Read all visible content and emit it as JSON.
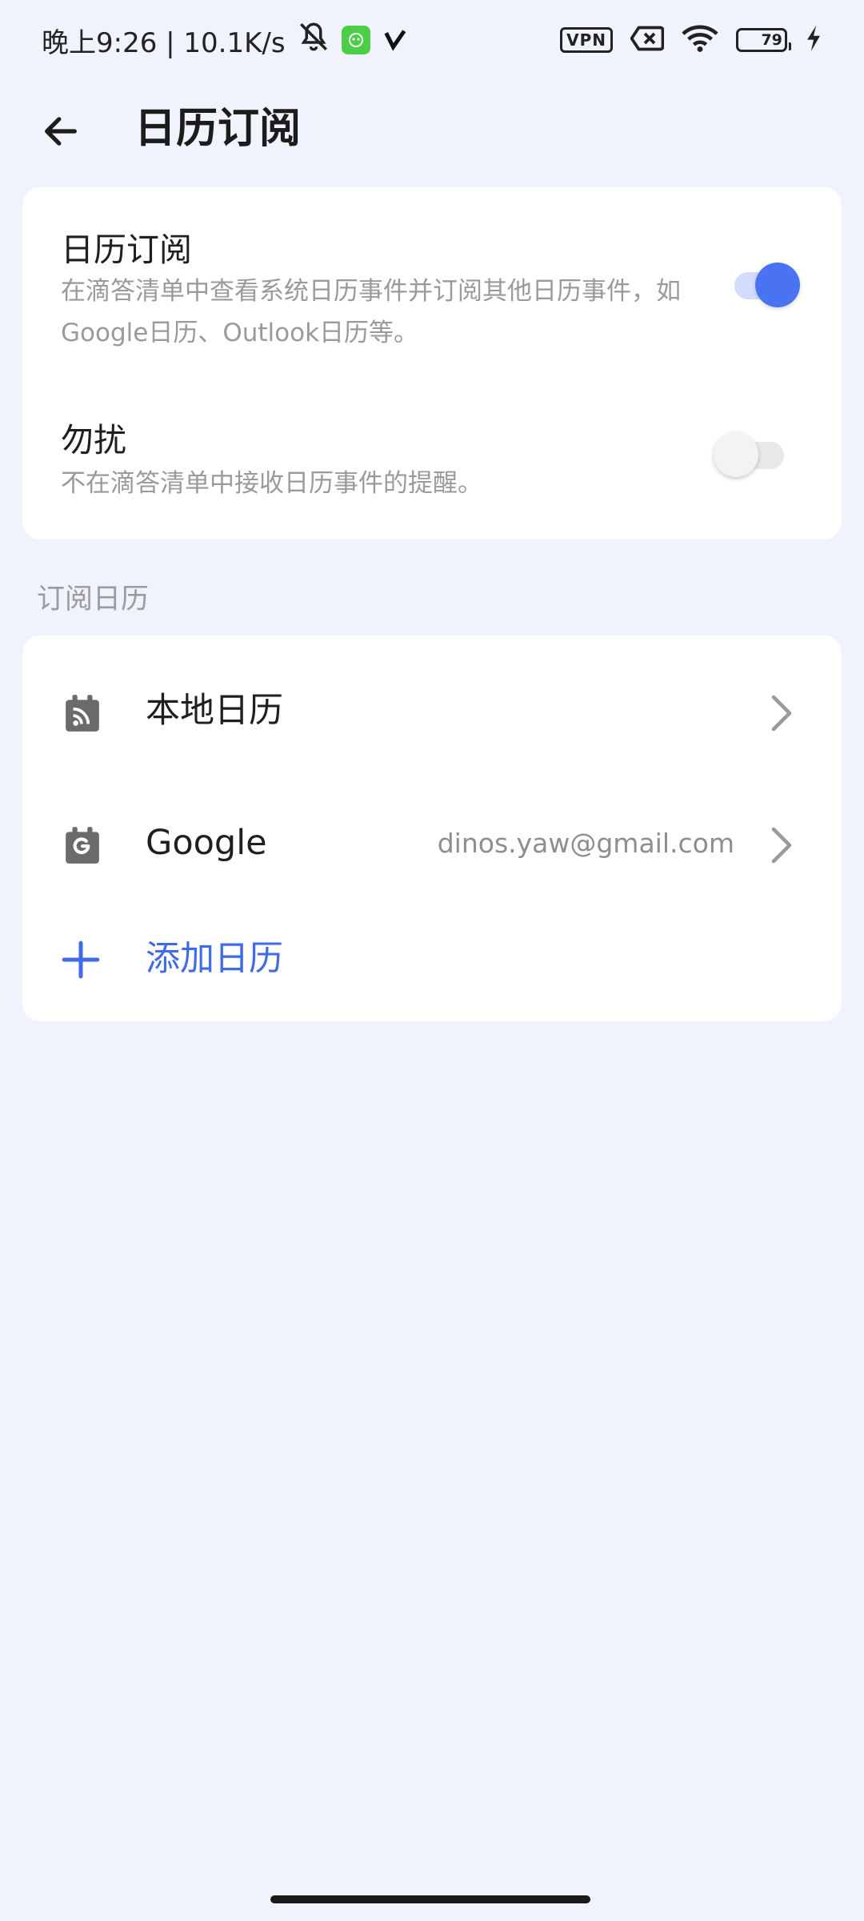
{
  "status_bar": {
    "time_network": "晚上9:26 | 10.1K/s",
    "vpn_label": "VPN",
    "battery_level": "79",
    "icons": [
      "mute-icon",
      "app-notification-icon",
      "v-app-icon",
      "vpn-icon",
      "sim-error-icon",
      "wifi-icon",
      "battery-icon",
      "charging-icon"
    ]
  },
  "header": {
    "title": "日历订阅"
  },
  "settings": {
    "calendar_subscription": {
      "title": "日历订阅",
      "description": "在滴答清单中查看系统日历事件并订阅其他日历事件，如Google日历、Outlook日历等。",
      "enabled": true
    },
    "do_not_disturb": {
      "title": "勿扰",
      "description": "不在滴答清单中接收日历事件的提醒。",
      "enabled": false
    }
  },
  "subscribed": {
    "section_title": "订阅日历",
    "items": [
      {
        "label": "本地日历",
        "account": "",
        "icon": "local-calendar-icon"
      },
      {
        "label": "Google",
        "account": "dinos.yaw@gmail.com",
        "icon": "google-calendar-icon"
      }
    ],
    "add_label": "添加日历"
  },
  "colors": {
    "accent": "#4a73f1",
    "background": "#f0f3fc",
    "card": "#ffffff",
    "secondary_text": "#9a9a9a"
  }
}
